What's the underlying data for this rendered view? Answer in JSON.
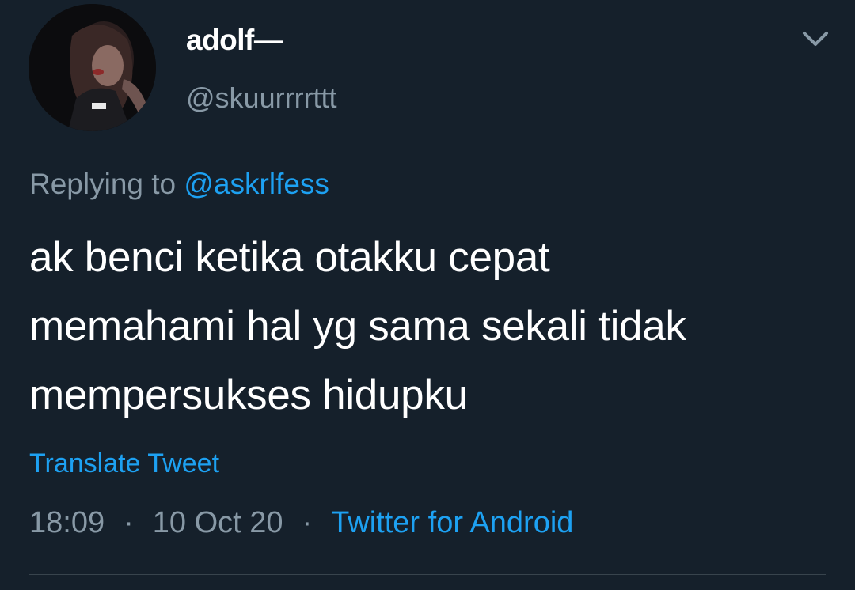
{
  "user": {
    "display_name": "adolf—",
    "handle": "@skuurrrrttt",
    "avatar_icon": "profile-photo"
  },
  "reply": {
    "prefix": "Replying to ",
    "mention": "@askrlfess"
  },
  "tweet": {
    "lines": [
      "ak benci ketika otakku cepat",
      "memahami hal yg sama sekali tidak",
      "mempersukses hidupku"
    ],
    "translate_label": "Translate Tweet"
  },
  "meta": {
    "time": "18:09",
    "separator": "·",
    "date": "10 Oct 20",
    "source": "Twitter for Android"
  },
  "icons": {
    "menu": "chevron-down-icon"
  },
  "colors": {
    "background": "#15202b",
    "accent": "#1da1f2",
    "secondary_text": "#8899a6",
    "divider": "#38444d"
  }
}
